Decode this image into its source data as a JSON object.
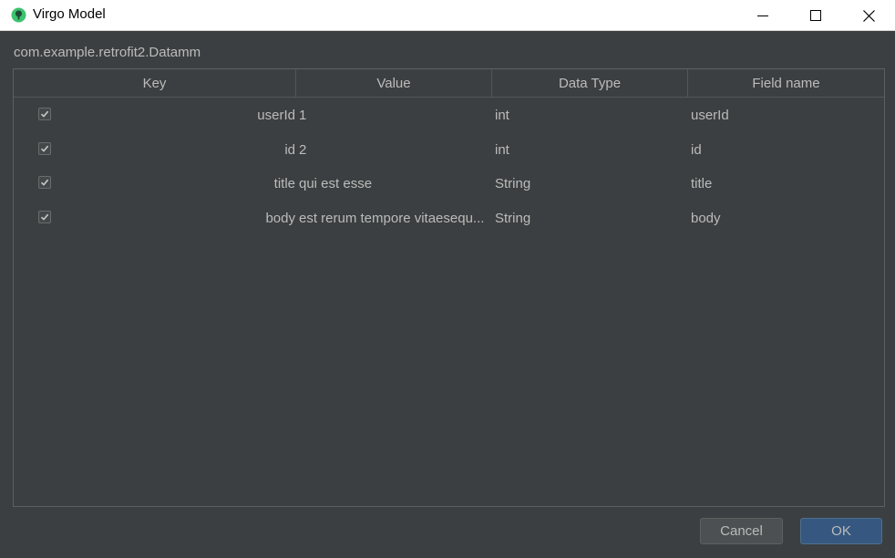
{
  "window": {
    "title": "Virgo Model",
    "icon": "virgo-app-icon",
    "controls": [
      "minimize-icon",
      "maximize-icon",
      "close-icon"
    ]
  },
  "package": "com.example.retrofit2.Datamm",
  "table": {
    "columns": [
      "Key",
      "Value",
      "Data Type",
      "Field name"
    ],
    "rows": [
      {
        "checked": true,
        "key": "userId",
        "value": "1",
        "dtype": "int",
        "field": "userId"
      },
      {
        "checked": true,
        "key": "id",
        "value": "2",
        "dtype": "int",
        "field": "id"
      },
      {
        "checked": true,
        "key": "title",
        "value": "qui est esse",
        "dtype": "String",
        "field": "title"
      },
      {
        "checked": true,
        "key": "body",
        "value": "est rerum tempore vitaesequ...",
        "dtype": "String",
        "field": "body"
      }
    ]
  },
  "buttons": {
    "cancel": "Cancel",
    "ok": "OK"
  },
  "colors": {
    "background": "#3c3f41",
    "text": "#bbbbbb",
    "primary_button": "#365880",
    "titlebar": "#ffffff"
  }
}
